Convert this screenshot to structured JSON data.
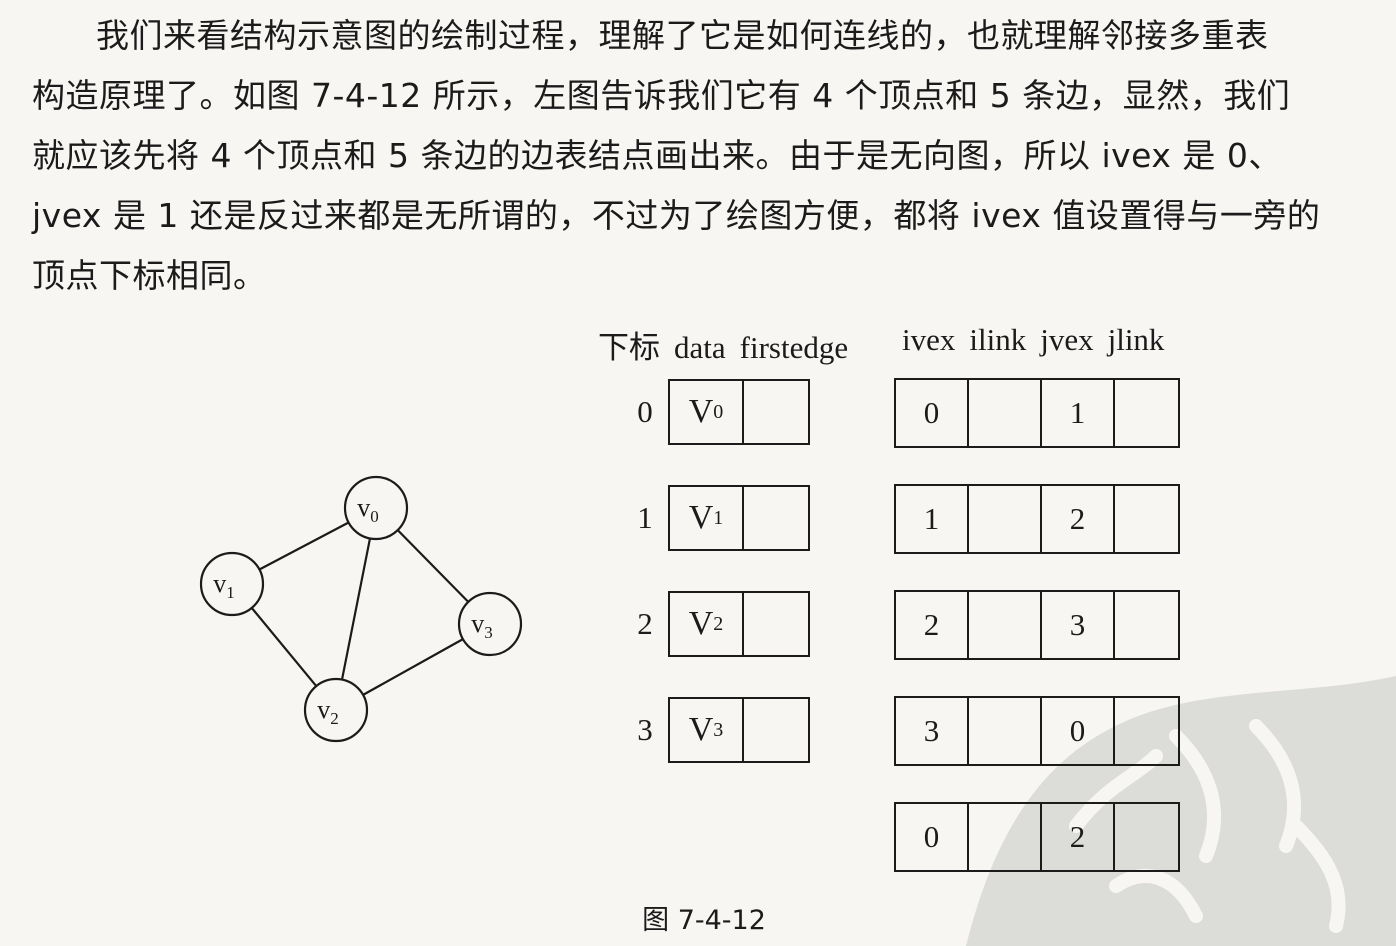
{
  "paragraph": [
    "我们来看结构示意图的绘制过程，理解了它是如何连线的，也就理解邻接多重表",
    "构造原理了。如图 7-4-12 所示，左图告诉我们它有 4 个顶点和 5 条边，显然，我们",
    "就应该先将 4 个顶点和 5 条边的边表结点画出来。由于是无向图，所以 ivex 是 0、",
    "jvex 是 1 还是反过来都是无所谓的，不过为了绘图方便，都将 ivex 值设置得与一旁的",
    "顶点下标相同。"
  ],
  "graph": {
    "nodes": [
      {
        "label": "V",
        "sub": "0"
      },
      {
        "label": "V",
        "sub": "1"
      },
      {
        "label": "V",
        "sub": "2"
      },
      {
        "label": "V",
        "sub": "3"
      }
    ],
    "edges": [
      [
        0,
        1
      ],
      [
        0,
        2
      ],
      [
        0,
        3
      ],
      [
        1,
        2
      ],
      [
        2,
        3
      ]
    ]
  },
  "vertex_table": {
    "headers": [
      "下标",
      "data",
      "firstedge"
    ],
    "rows": [
      {
        "index": "0",
        "data": "V",
        "sub": "0"
      },
      {
        "index": "1",
        "data": "V",
        "sub": "1"
      },
      {
        "index": "2",
        "data": "V",
        "sub": "2"
      },
      {
        "index": "3",
        "data": "V",
        "sub": "3"
      }
    ]
  },
  "edge_table": {
    "headers": [
      "ivex",
      "ilink",
      "jvex",
      "jlink"
    ],
    "rows": [
      {
        "ivex": "0",
        "ilink": "",
        "jvex": "1",
        "jlink": ""
      },
      {
        "ivex": "1",
        "ilink": "",
        "jvex": "2",
        "jlink": ""
      },
      {
        "ivex": "2",
        "ilink": "",
        "jvex": "3",
        "jlink": ""
      },
      {
        "ivex": "3",
        "ilink": "",
        "jvex": "0",
        "jlink": ""
      },
      {
        "ivex": "0",
        "ilink": "",
        "jvex": "2",
        "jlink": ""
      }
    ]
  },
  "caption": "图 7-4-12"
}
